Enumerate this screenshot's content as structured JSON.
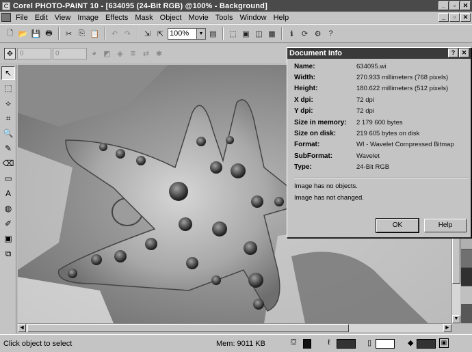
{
  "app": {
    "title": "Corel PHOTO-PAINT 10 - [634095 (24-Bit RGB) @100% - Background]"
  },
  "window_buttons": [
    "_",
    "▫",
    "✕"
  ],
  "menu": [
    "File",
    "Edit",
    "View",
    "Image",
    "Effects",
    "Mask",
    "Object",
    "Movie",
    "Tools",
    "Window",
    "Help"
  ],
  "toolbar": {
    "zoom_value": "100%"
  },
  "spin_fields": [
    "0",
    "0"
  ],
  "dialog": {
    "title": "Document Info",
    "help_btn": "?",
    "close_btn": "✕",
    "rows": [
      {
        "label": "Name:",
        "value": "634095.wi"
      },
      {
        "label": "Width:",
        "value": "270.933 millimeters  (768 pixels)"
      },
      {
        "label": "Height:",
        "value": "180.622 millimeters  (512 pixels)"
      },
      {
        "label": "X dpi:",
        "value": "72 dpi"
      },
      {
        "label": "Y dpi:",
        "value": "72 dpi"
      },
      {
        "label": "Size in memory:",
        "value": "2 179 600 bytes"
      },
      {
        "label": "Size on disk:",
        "value": "219 605 bytes on disk"
      },
      {
        "label": "Format:",
        "value": "WI - Wavelet Compressed Bitmap"
      },
      {
        "label": "SubFormat:",
        "value": "Wavelet"
      },
      {
        "label": "Type:",
        "value": "24-Bit RGB"
      }
    ],
    "message1": "Image has no objects.",
    "message2": "Image has not changed.",
    "ok_label": "OK",
    "help_label": "Help"
  },
  "status": {
    "hint": "Click object to select",
    "memory": "Mem: 9011 KB"
  },
  "colors": {
    "title_bar": "#4a4a4a",
    "chrome": "#c4c4c4",
    "dialog_title": "#3a3a3a"
  }
}
